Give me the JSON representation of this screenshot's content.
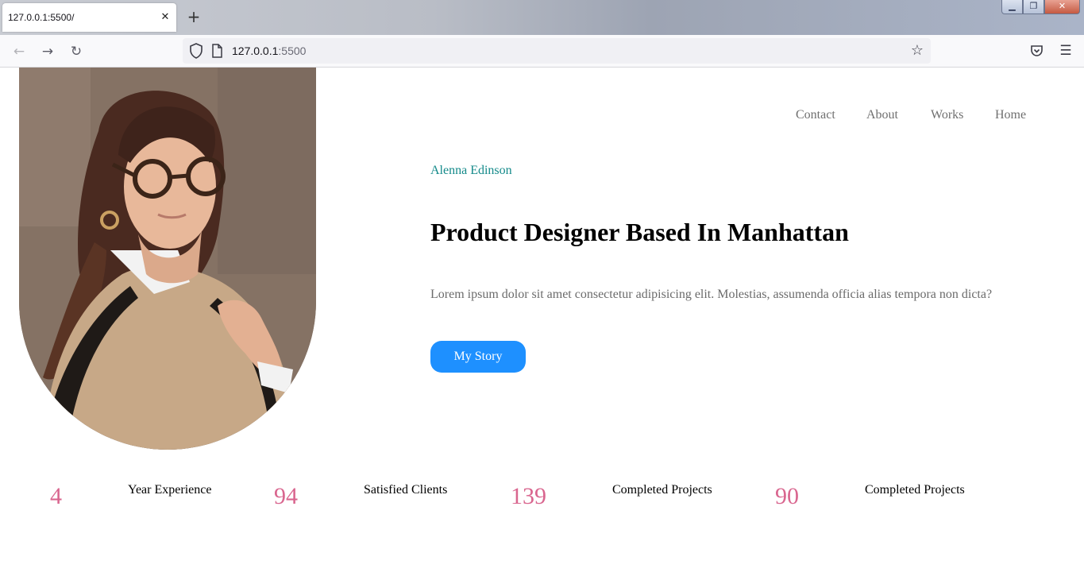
{
  "browser": {
    "tab_title": "127.0.0.1:5500/",
    "tab_close": "✕",
    "new_tab": "+",
    "url_host": "127.0.0.1",
    "url_port": ":5500",
    "back_icon": "←",
    "forward_icon": "→",
    "reload_icon": "↻",
    "star_icon": "☆",
    "menu_icon": "☰",
    "window_controls": {
      "minimize": "▁",
      "maximize": "❐",
      "close": "✕"
    }
  },
  "site_nav": {
    "items": [
      {
        "label": "Contact"
      },
      {
        "label": "About"
      },
      {
        "label": "Works"
      },
      {
        "label": "Home"
      }
    ]
  },
  "hero": {
    "name": "Alenna Edinson",
    "title": "Product Designer Based In Manhattan",
    "description": "Lorem ipsum dolor sit amet consectetur adipisicing elit. Molestias, assumenda officia alias tempora non dicta?",
    "button_label": "My Story",
    "photo_alt": "Portrait of a woman wearing glasses and a tan coat"
  },
  "stats": [
    {
      "value": "4",
      "label": "Year Experience"
    },
    {
      "value": "94",
      "label": "Satisfied Clients"
    },
    {
      "value": "139",
      "label": "Completed Projects"
    },
    {
      "value": "90",
      "label": "Completed Projects"
    }
  ],
  "colors": {
    "accent": "#148a8a",
    "button": "#1e90ff",
    "stat_number": "#d9668f"
  }
}
